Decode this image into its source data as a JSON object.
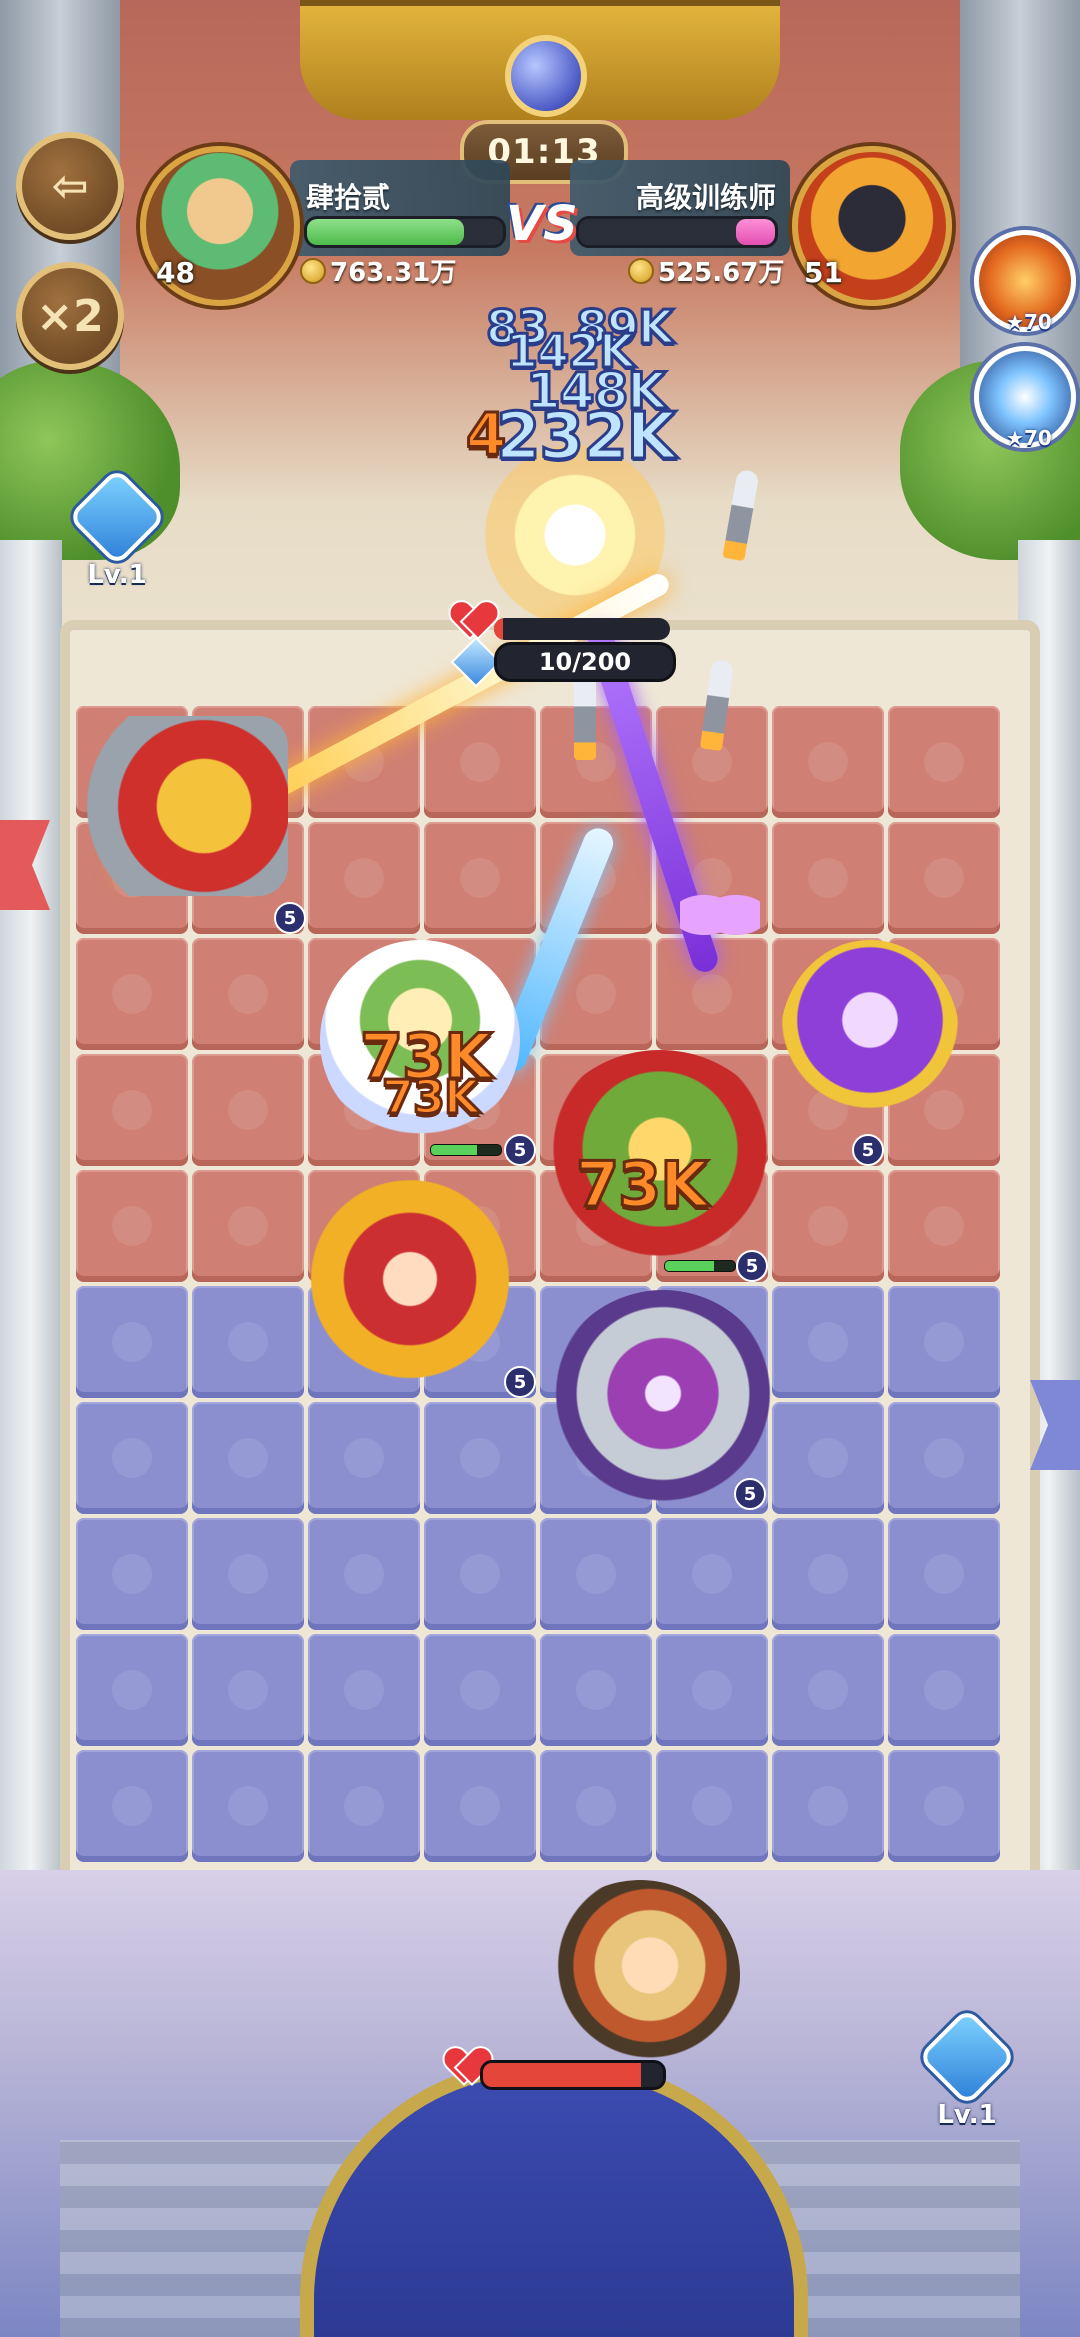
{
  "hud": {
    "timer": "01:13",
    "exit_icon": "exit-door-icon",
    "speed_label": "×2",
    "vs_label": "VS",
    "left_player": {
      "name": "肆拾贰",
      "level": "48",
      "gold": "763.31万",
      "hp_fraction": 0.8
    },
    "right_player": {
      "name": "高级训练师",
      "level": "51",
      "gold": "525.67万",
      "hp_fraction": 0.2
    },
    "skills": [
      {
        "icon": "fire-bomb-skill-icon",
        "cost": "70"
      },
      {
        "icon": "lightning-skill-icon",
        "cost": "70"
      }
    ]
  },
  "level_badges": {
    "top": "Lv.1",
    "bottom": "Lv.1"
  },
  "boss": {
    "hp_text": "10/200",
    "hp_fraction": 0.05
  },
  "hero": {
    "hp_fraction": 0.88
  },
  "damage_numbers": {
    "stack": [
      "83",
      "89K",
      "142K",
      "148K",
      "4",
      "232K"
    ],
    "queen_a": "73K",
    "queen_b": "73K",
    "beast": "73K"
  },
  "units": {
    "cannon_level": "5",
    "queen_level": "5",
    "beast_level": "5",
    "mage_level": "5",
    "monkey_level": "5",
    "knight_level": "5",
    "queen_hp_fraction": 0.65,
    "beast_hp_fraction": 0.7
  },
  "colors": {
    "enemy_tile": "#cf7f73",
    "ally_tile": "#8b8fd0",
    "left_hp": "#4dbb4a",
    "right_hp": "#e24fb3",
    "damage_orange": "#ff8a2a"
  }
}
